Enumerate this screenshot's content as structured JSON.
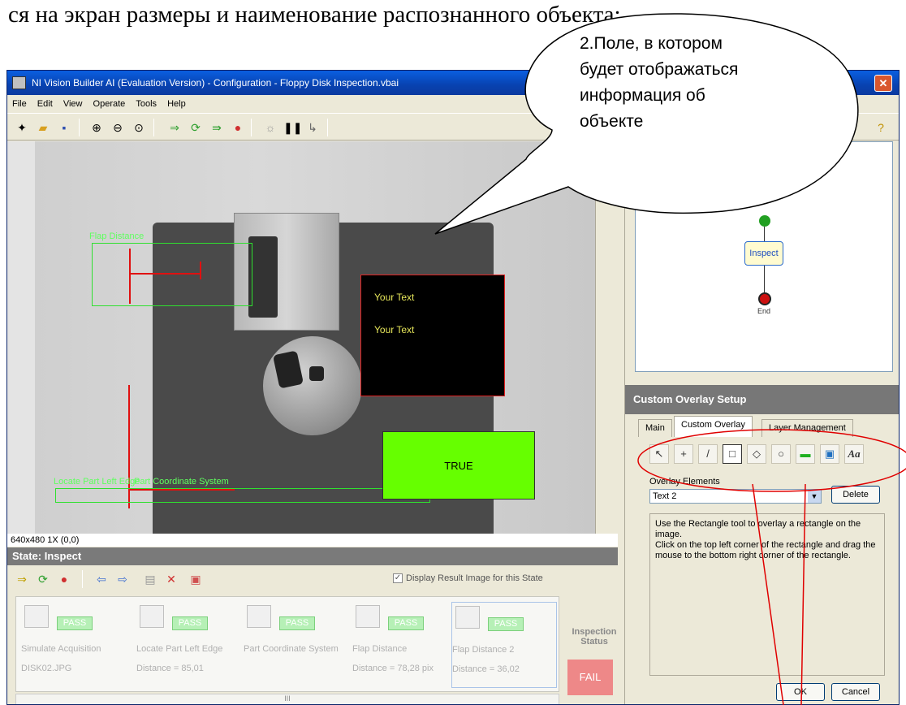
{
  "doc_caption": "ся на экран размеры и наименование распознанного объекта:",
  "window": {
    "title": "NI Vision Builder AI (Evaluation Version) - Configuration - Floppy Disk Inspection.vbai",
    "menu": [
      "File",
      "Edit",
      "View",
      "Operate",
      "Tools",
      "Help"
    ]
  },
  "image": {
    "status": "640x480 1X  (0,0)",
    "overlays": {
      "flap_distance": "Flap Distance",
      "locate_left": "Locate Part Left Edge",
      "part_coord": "Part Coordinate System",
      "text1": "Your Text",
      "text2": "Your Text",
      "true_label": "TRUE"
    }
  },
  "state": {
    "header": "State:  Inspect",
    "display_result": "Display Result Image for this State",
    "steps": [
      {
        "name": "Simulate Acquisition",
        "value": "DISK02.JPG",
        "status": "PASS"
      },
      {
        "name": "Locate Part Left Edge",
        "value": "Distance = 85,01",
        "status": "PASS"
      },
      {
        "name": "Part Coordinate System",
        "value": "",
        "status": "PASS"
      },
      {
        "name": "Flap Distance",
        "value": "Distance = 78,28 pix",
        "status": "PASS"
      },
      {
        "name": "Flap Distance 2",
        "value": "Distance = 36,02",
        "status": "PASS"
      }
    ],
    "inspection_status_label": "Inspection Status",
    "inspection_result": "FAIL",
    "scroll_marker": "III"
  },
  "flow": {
    "inspect": "Inspect",
    "end": "End"
  },
  "overlay_setup": {
    "header": "Custom Overlay Setup",
    "tabs": [
      "Main",
      "Custom Overlay",
      "Layer Management"
    ],
    "tools": [
      "↖",
      "+",
      "/",
      "□",
      "◇",
      "○",
      "▬",
      "▣",
      "Aa"
    ],
    "elements_label": "Overlay Elements",
    "selected_element": "Text 2",
    "delete": "Delete",
    "help": "Use the Rectangle tool to overlay a rectangle on the image.\nClick on the top left corner of the rectangle and drag the mouse to the bottom right corner of the rectangle.",
    "ok": "OK",
    "cancel": "Cancel"
  },
  "callout": "2.Поле, в котором будет отображаться информация об объекте",
  "colors": {
    "annotation": "#e00000",
    "overlay_green": "#2fe02f",
    "true_fill": "#66ff00",
    "fail_fill": "#ee8888"
  }
}
